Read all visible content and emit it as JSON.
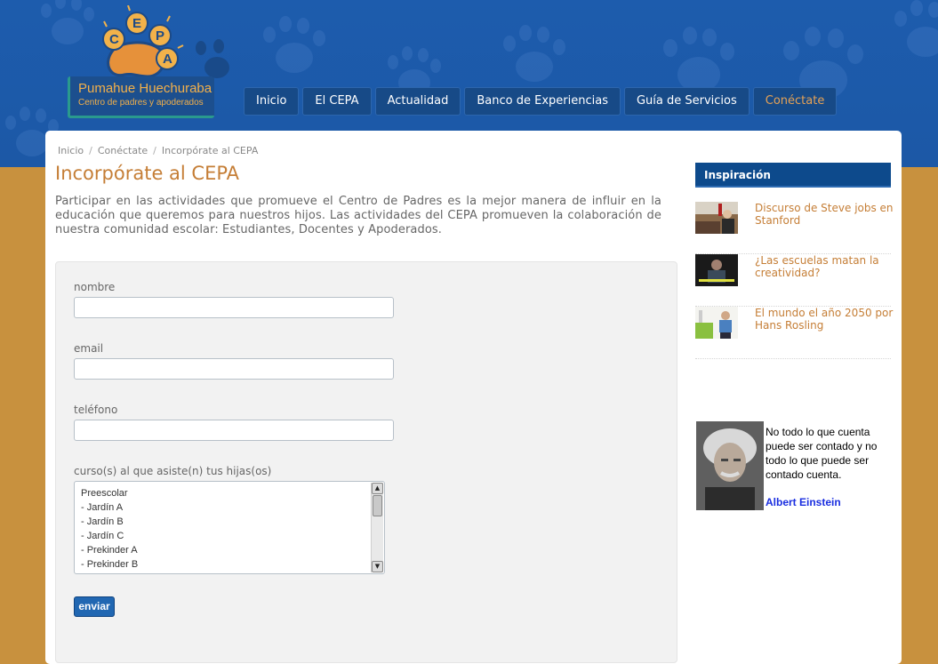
{
  "site": {
    "logo_letters": [
      "C",
      "E",
      "P",
      "A"
    ],
    "brand_name": "Pumahue Huechuraba",
    "brand_subtitle": "Centro de padres y apoderados"
  },
  "nav": [
    {
      "label": "Inicio",
      "active": false
    },
    {
      "label": "El CEPA",
      "active": false
    },
    {
      "label": "Actualidad",
      "active": false
    },
    {
      "label": "Banco de Experiencias",
      "active": false
    },
    {
      "label": "Guía de Servicios",
      "active": false
    },
    {
      "label": "Conéctate",
      "active": true
    }
  ],
  "breadcrumb": [
    "Inicio",
    "Conéctate",
    "Incorpórate al CEPA"
  ],
  "page": {
    "title": "Incorpórate al CEPA",
    "intro": "Participar en las actividades que promueve el Centro de Padres es la mejor manera de influir en la educación que queremos para nuestros hijos. Las actividades del CEPA promueven la colaboración de nuestra comunidad escolar: Estudiantes, Docentes y Apoderados."
  },
  "form": {
    "name_label": "nombre",
    "name_value": "",
    "email_label": "email",
    "email_value": "",
    "phone_label": "teléfono",
    "phone_value": "",
    "courses_label": "curso(s) al que asiste(n) tus hijas(os)",
    "courses": [
      "Preescolar",
      "- Jardín A",
      "- Jardín B",
      "- Jardín C",
      "- Prekinder A",
      "- Prekinder B"
    ],
    "submit_label": "enviar"
  },
  "sidebar": {
    "heading": "Inspiración",
    "items": [
      {
        "title": "Discurso de Steve jobs en Stanford"
      },
      {
        "title": "¿Las escuelas matan la creatividad?"
      },
      {
        "title": "El mundo el año 2050 por Hans Rosling"
      }
    ],
    "quote": {
      "text": "No todo lo que cuenta puede ser contado y no todo lo que puede ser contado cuenta.",
      "author": "Albert Einstein"
    }
  },
  "colors": {
    "header_blue": "#1d5cad",
    "page_tan": "#c8913e",
    "accent_orange": "#c57e36",
    "nav_active": "#e6a255"
  }
}
